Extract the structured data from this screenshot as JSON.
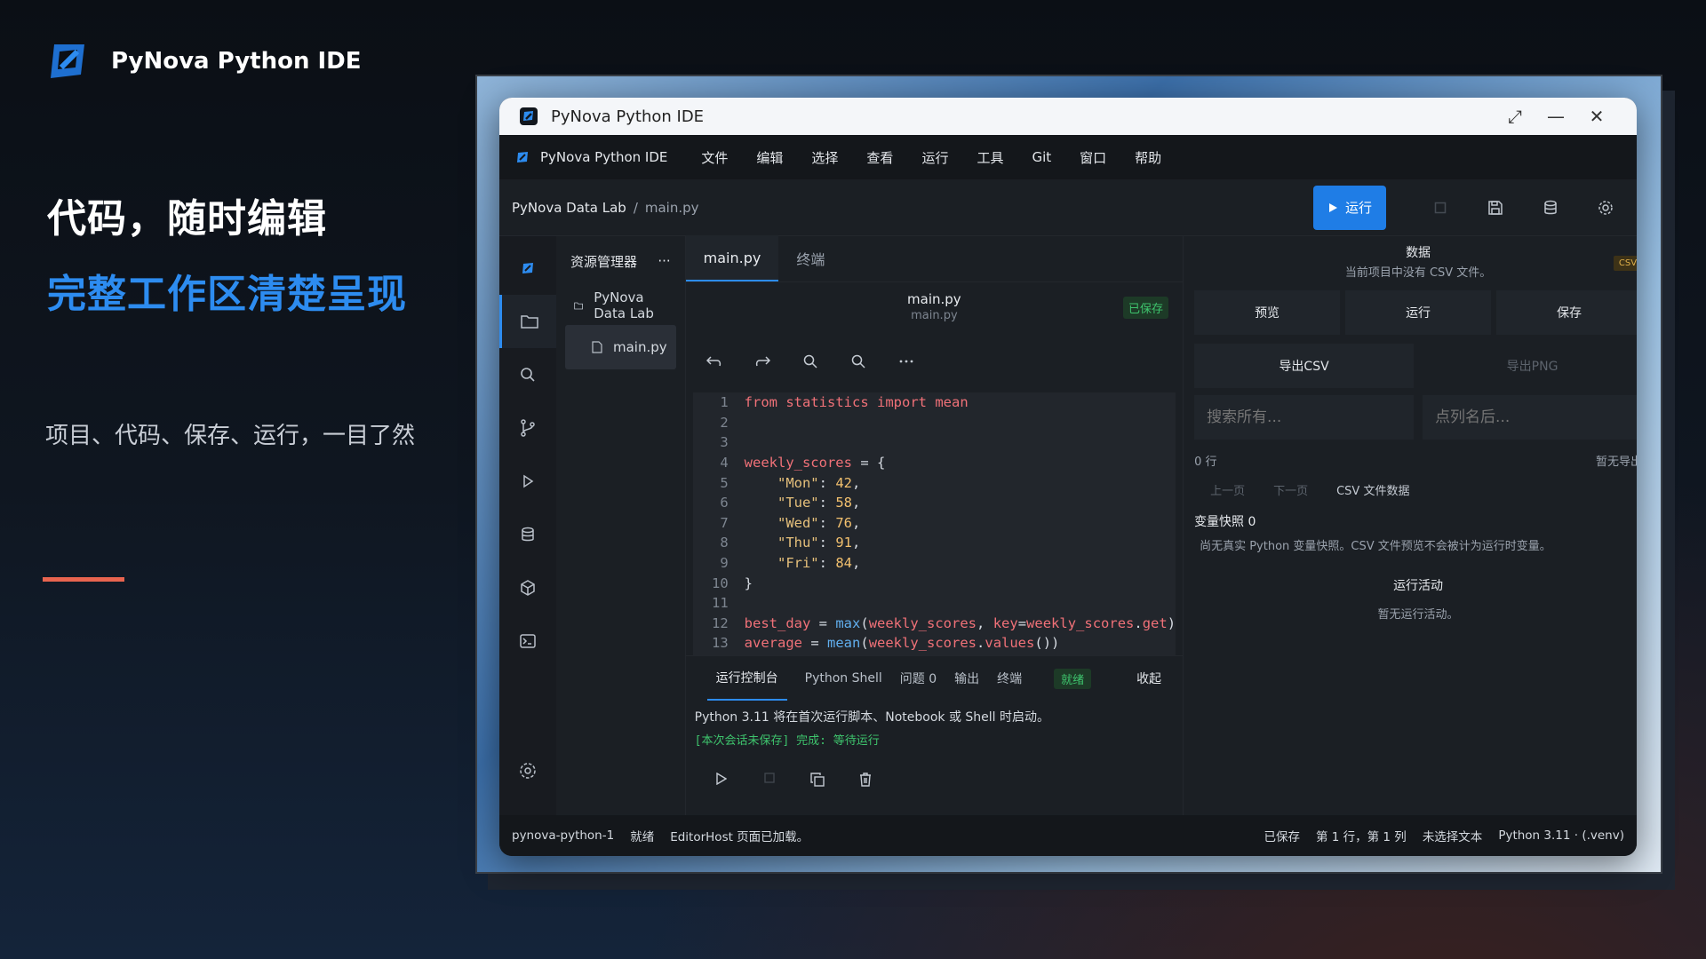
{
  "brand": {
    "name": "PyNova Python IDE"
  },
  "marketing": {
    "headline": "代码，随时编辑",
    "subheadline": "完整工作区清楚呈现",
    "tagline": "项目、代码、保存、运行，一目了然"
  },
  "colors": {
    "accent": "#2d8cf0",
    "run_button": "#1f7de6",
    "saved": "#3ec46d",
    "csv_badge": "#e0b04a",
    "divider": "#e8644f"
  },
  "window": {
    "title": "PyNova Python IDE",
    "controls": {
      "maximize": "⤢",
      "minimize": "—",
      "close": "✕"
    }
  },
  "menubar": {
    "app_label": "PyNova Python IDE",
    "items": [
      "文件",
      "编辑",
      "选择",
      "查看",
      "运行",
      "工具",
      "Git",
      "窗口",
      "帮助"
    ]
  },
  "toolbar": {
    "breadcrumb_project": "PyNova Data Lab",
    "breadcrumb_sep": "/",
    "breadcrumb_file": "main.py",
    "run_label": "运行",
    "icons": [
      "stop-icon",
      "save-icon",
      "database-icon",
      "settings-icon"
    ]
  },
  "activity_bar": [
    "logo-icon",
    "folder-icon",
    "search-icon",
    "git-branch-icon",
    "run-icon",
    "database-icon",
    "package-icon",
    "terminal-icon",
    "settings-icon"
  ],
  "explorer": {
    "title": "资源管理器",
    "more": "···",
    "project": "PyNova Data Lab",
    "file": "main.py"
  },
  "editor": {
    "tabs": [
      "main.py",
      "终端"
    ],
    "file_name": "main.py",
    "file_path": "main.py",
    "saved_badge": "已保存",
    "tools": [
      "undo-icon",
      "redo-icon",
      "search-icon",
      "replace-icon",
      "more-icon"
    ]
  },
  "code_lines": [
    {
      "n": "1",
      "html": "<span class=\"kw\">from</span> <span class=\"id\">statistics</span> <span class=\"kw\">import</span> <span class=\"id\">mean</span>"
    },
    {
      "n": "2",
      "html": ""
    },
    {
      "n": "3",
      "html": ""
    },
    {
      "n": "4",
      "html": "<span class=\"id\">weekly_scores</span> <span class=\"pl\">= {</span>"
    },
    {
      "n": "5",
      "html": "    <span class=\"str\">\"Mon\"</span><span class=\"pl\">:</span> <span class=\"num\">42</span><span class=\"pl\">,</span>"
    },
    {
      "n": "6",
      "html": "    <span class=\"str\">\"Tue\"</span><span class=\"pl\">:</span> <span class=\"num\">58</span><span class=\"pl\">,</span>"
    },
    {
      "n": "7",
      "html": "    <span class=\"str\">\"Wed\"</span><span class=\"pl\">:</span> <span class=\"num\">76</span><span class=\"pl\">,</span>"
    },
    {
      "n": "8",
      "html": "    <span class=\"str\">\"Thu\"</span><span class=\"pl\">:</span> <span class=\"num\">91</span><span class=\"pl\">,</span>"
    },
    {
      "n": "9",
      "html": "    <span class=\"str\">\"Fri\"</span><span class=\"pl\">:</span> <span class=\"num\">84</span><span class=\"pl\">,</span>"
    },
    {
      "n": "10",
      "html": "<span class=\"pl\">}</span>"
    },
    {
      "n": "11",
      "html": ""
    },
    {
      "n": "12",
      "html": "<span class=\"id\">best_day</span> <span class=\"pl\">=</span> <span class=\"fnc\">max</span><span class=\"pl\">(</span><span class=\"id\">weekly_scores</span><span class=\"pl\">,</span> <span class=\"id\">key</span><span class=\"pl\">=</span><span class=\"id\">weekly_scores</span><span class=\"pl\">.</span><span class=\"id\">get</span><span class=\"pl\">)</span>"
    },
    {
      "n": "13",
      "html": "<span class=\"id\">average</span> <span class=\"pl\">=</span> <span class=\"fnc\">mean</span><span class=\"pl\">(</span><span class=\"id\">weekly_scores</span><span class=\"pl\">.</span><span class=\"id\">values</span><span class=\"pl\">())</span>"
    }
  ],
  "console": {
    "tabs": [
      "运行控制台",
      "Python Shell",
      "问题 0",
      "输出",
      "终端"
    ],
    "ready": "就绪",
    "collapse": "收起",
    "message": "Python 3.11 将在首次运行脚本、Notebook 或 Shell 时启动。",
    "status": "[本次会话未保存] 完成: 等待运行",
    "actions": [
      "play-icon",
      "stop-icon",
      "copy-icon",
      "trash-icon"
    ]
  },
  "data_panel": {
    "title": "数据",
    "subtitle": "当前项目中没有 CSV 文件。",
    "csv_badge": "CSV",
    "buttons": [
      "预览",
      "运行",
      "保存"
    ],
    "export_csv": "导出CSV",
    "export_png": "导出PNG",
    "search_placeholder": "搜索所有...",
    "column_placeholder": "点列名后...",
    "row_count": "0 行",
    "export_status": "暂无导出",
    "prev": "上一页",
    "next": "下一页",
    "csv_label": "CSV 文件数据",
    "vars_title": "变量快照 0",
    "vars_text": "尚无真实 Python 变量快照。CSV 文件预览不会被计为运行时变量。",
    "activity_title": "运行活动",
    "activity_text": "暂无运行活动。"
  },
  "statusbar": {
    "session": "pynova-python-1",
    "ready": "就绪",
    "host": "EditorHost 页面已加载。",
    "saved": "已保存",
    "position": "第 1 行，第 1 列",
    "selection": "未选择文本",
    "interpreter": "Python 3.11 · (.venv)"
  }
}
